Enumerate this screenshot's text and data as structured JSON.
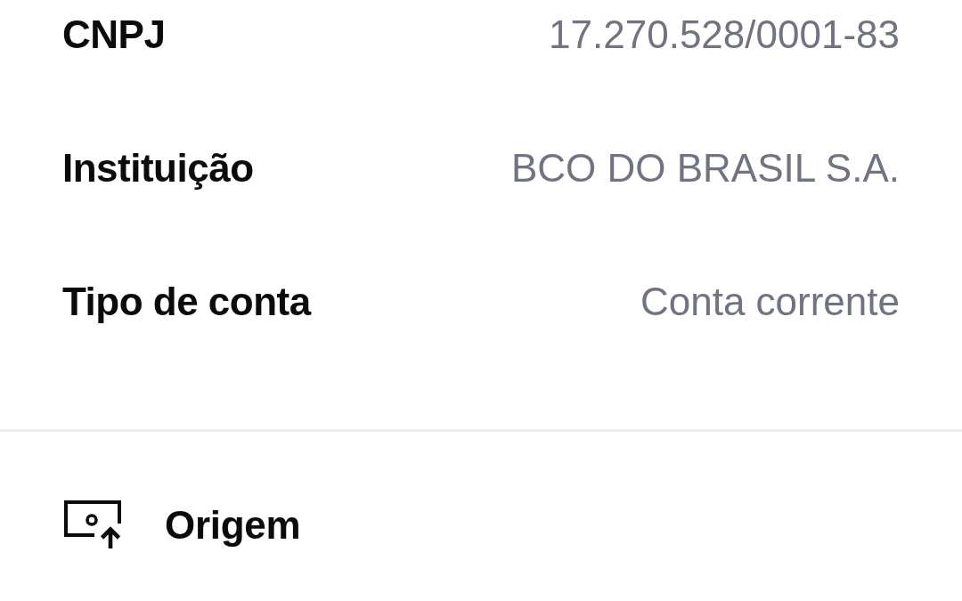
{
  "details": [
    {
      "label": "CNPJ",
      "value": "17.270.528/0001-83"
    },
    {
      "label": "Instituição",
      "value": "BCO DO BRASIL S.A."
    },
    {
      "label": "Tipo de conta",
      "value": "Conta corrente"
    }
  ],
  "section": {
    "title": "Origem"
  }
}
